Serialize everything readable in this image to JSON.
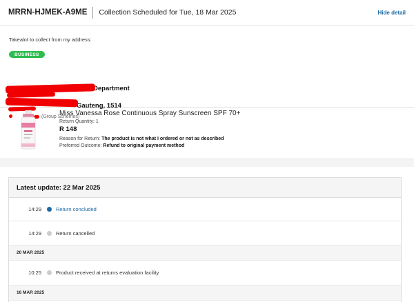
{
  "header": {
    "reference": "MRRN-HJMEK-A9ME",
    "schedule_text": "Collection Scheduled for Tue, 18 Mar 2025",
    "hide_link": "Hide detail"
  },
  "address": {
    "intro": "Takealot to collect from my address:",
    "badge": "BUSINESS",
    "line1_visible": "Department",
    "line2_visible": "Gauteng, 1514",
    "line3_visible": "(Group Schemes)",
    "redaction_color": "#f00000"
  },
  "product": {
    "name": "Miss Vanessa Rose Continuous Spray Sunscreen SPF 70+",
    "quantity": "Return Quantity: 1",
    "price": "R 148",
    "reason_label": "Reason for Return:",
    "reason_value": "The product is not what I ordered or not as described",
    "outcome_label": "Preferred Outcome:",
    "outcome_value": "Refund to original payment method"
  },
  "timeline": {
    "title": "Latest update: 22 Mar 2025",
    "accent_color": "#1b6aa5",
    "events": [
      {
        "time": "14:29",
        "text": "Return concluded",
        "active": true
      },
      {
        "time": "14:29",
        "text": "Return cancelled",
        "active": false
      }
    ],
    "date_1": "20 MAR 2025",
    "events_2": [
      {
        "time": "10:25",
        "text": "Product received at returns evaluation facility",
        "active": false
      }
    ],
    "date_2": "16 MAR 2025"
  }
}
